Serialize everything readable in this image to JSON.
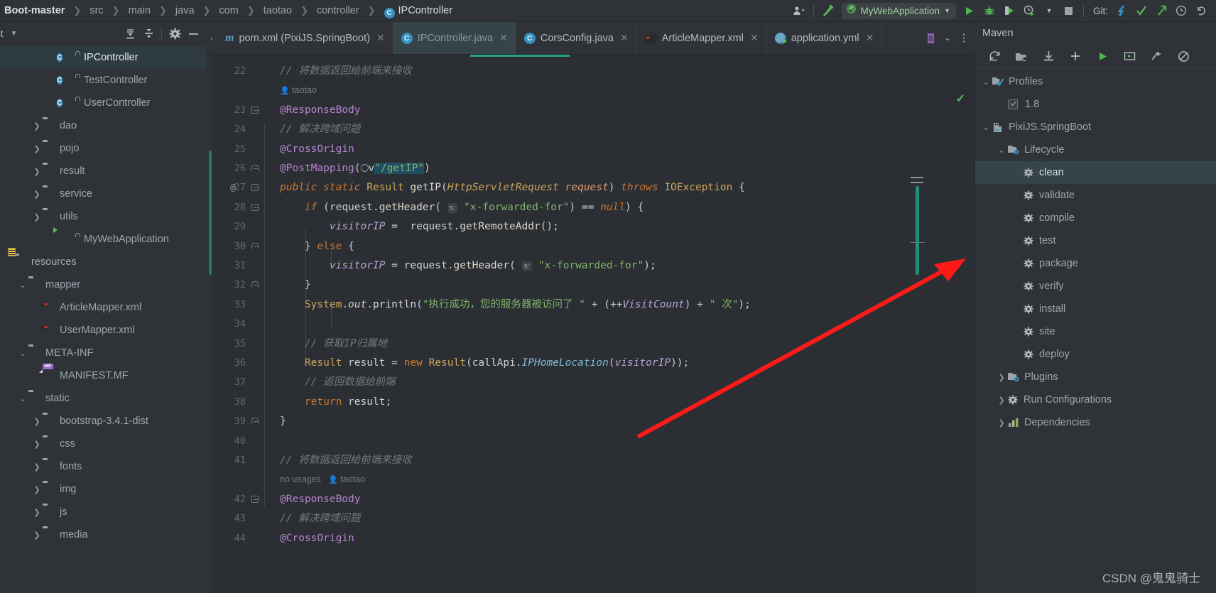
{
  "window": {
    "breadcrumb": [
      "Boot-master",
      "src",
      "main",
      "java",
      "com",
      "taotao",
      "controller",
      "IPController"
    ],
    "class_badge": "C"
  },
  "toolbar": {
    "profile_icon": "user-profile-icon",
    "hammer_icon": "build-hammer-icon",
    "run_config_name": "MyWebApplication",
    "run_config_icon": "spring-boot-icon",
    "dropdown_icon": "chevron-down-icon",
    "run_icon": "run-play-icon",
    "debug_icon": "debug-bug-icon",
    "run_coverage_icon": "run-with-coverage-icon",
    "profiler_icon": "profiler-clock-icon",
    "stop_icon": "stop-square-icon",
    "git_label": "Git:",
    "git_update_icon": "update-project-icon",
    "git_commit_icon": "commit-checkmark-icon",
    "git_push_icon": "push-arrow-icon",
    "git_history_icon": "history-clock-icon",
    "git_rollback_icon": "rollback-undo-icon"
  },
  "project_panel": {
    "title": "ct",
    "caret_icon": "chevron-down-icon",
    "tools": [
      "expand-all-icon",
      "collapse-all-icon",
      "gear-icon",
      "hide-minus-icon"
    ],
    "tree": [
      {
        "label": "IPController",
        "indent": 4,
        "icon": "java-class-icon",
        "lock": true,
        "twist": "",
        "selected": true
      },
      {
        "label": "TestController",
        "indent": 4,
        "icon": "java-class-icon",
        "lock": true,
        "twist": "",
        "selected": false
      },
      {
        "label": "UserController",
        "indent": 4,
        "icon": "java-class-icon",
        "lock": true,
        "twist": "",
        "selected": false
      },
      {
        "label": "dao",
        "indent": 3,
        "icon": "source-folder-icon",
        "lock": false,
        "twist": ">",
        "selected": false
      },
      {
        "label": "pojo",
        "indent": 3,
        "icon": "source-folder-icon",
        "lock": false,
        "twist": ">",
        "selected": false
      },
      {
        "label": "result",
        "indent": 3,
        "icon": "source-folder-icon",
        "lock": false,
        "twist": ">",
        "selected": false
      },
      {
        "label": "service",
        "indent": 3,
        "icon": "source-folder-icon",
        "lock": false,
        "twist": ">",
        "selected": false
      },
      {
        "label": "utils",
        "indent": 3,
        "icon": "source-folder-icon",
        "lock": false,
        "twist": ">",
        "selected": false
      },
      {
        "label": "MyWebApplication",
        "indent": 4,
        "icon": "spring-boot-run-icon",
        "lock": true,
        "twist": "",
        "selected": false
      },
      {
        "label": "resources",
        "indent": 1,
        "icon": "resource-folder-icon",
        "lock": false,
        "twist": "",
        "selected": false
      },
      {
        "label": "mapper",
        "indent": 2,
        "icon": "folder-icon",
        "lock": false,
        "twist": "v",
        "selected": false
      },
      {
        "label": "ArticleMapper.xml",
        "indent": 3,
        "icon": "mybatis-file-icon",
        "lock": false,
        "twist": "",
        "selected": false
      },
      {
        "label": "UserMapper.xml",
        "indent": 3,
        "icon": "mybatis-file-icon",
        "lock": false,
        "twist": "",
        "selected": false
      },
      {
        "label": "META-INF",
        "indent": 2,
        "icon": "folder-icon",
        "lock": false,
        "twist": "v",
        "selected": false
      },
      {
        "label": "MANIFEST.MF",
        "indent": 3,
        "icon": "manifest-file-icon",
        "lock": false,
        "twist": "",
        "selected": false
      },
      {
        "label": "static",
        "indent": 2,
        "icon": "folder-icon",
        "lock": false,
        "twist": "v",
        "selected": false
      },
      {
        "label": "bootstrap-3.4.1-dist",
        "indent": 3,
        "icon": "folder-icon",
        "lock": false,
        "twist": ">",
        "selected": false
      },
      {
        "label": "css",
        "indent": 3,
        "icon": "folder-icon",
        "lock": false,
        "twist": ">",
        "selected": false
      },
      {
        "label": "fonts",
        "indent": 3,
        "icon": "folder-icon",
        "lock": false,
        "twist": ">",
        "selected": false
      },
      {
        "label": "img",
        "indent": 3,
        "icon": "folder-icon",
        "lock": false,
        "twist": ">",
        "selected": false
      },
      {
        "label": "js",
        "indent": 3,
        "icon": "folder-icon",
        "lock": false,
        "twist": ">",
        "selected": false
      },
      {
        "label": "media",
        "indent": 3,
        "icon": "folder-icon",
        "lock": false,
        "twist": ">",
        "selected": false
      }
    ]
  },
  "editor": {
    "tabs": [
      {
        "label": "pom.xml (PixiJS.SpringBoot)",
        "icon": "maven-m-icon",
        "active": false,
        "closable": true
      },
      {
        "label": "IPController.java",
        "icon": "java-class-icon",
        "active": true,
        "closable": true
      },
      {
        "label": "CorsConfig.java",
        "icon": "java-class-icon",
        "active": false,
        "closable": true
      },
      {
        "label": "ArticleMapper.xml",
        "icon": "mybatis-file-icon",
        "active": false,
        "closable": true
      },
      {
        "label": "application.yml",
        "icon": "spring-yaml-icon",
        "active": false,
        "closable": true
      }
    ],
    "tab_right_buttons": [
      "yaml-file-icon",
      "chevron-down-icon",
      "more-vertical-icon"
    ],
    "inspection_status_icon": "inspections-ok-check",
    "lines": [
      {
        "no": "22",
        "kind": "code",
        "fold": "",
        "at": false,
        "html": "<span class=\"cmt\">// 将数据返回给前端来接收</span>"
      },
      {
        "no": "",
        "kind": "author",
        "text": "taotao"
      },
      {
        "no": "23",
        "kind": "code",
        "fold": "down",
        "at": false,
        "html": "<span class=\"anno\">@ResponseBody</span>"
      },
      {
        "no": "24",
        "kind": "code",
        "fold": "",
        "at": false,
        "html": "<span class=\"cmt\">// 解决跨域问题</span>"
      },
      {
        "no": "25",
        "kind": "code",
        "fold": "",
        "at": false,
        "html": "<span class=\"anno\">@CrossOrigin</span>"
      },
      {
        "no": "26",
        "kind": "code",
        "fold": "up",
        "at": false,
        "html": "<span class=\"anno\">@PostMapping</span><span class=\"pun\">(</span><span class=\"web-ic\"></span><span class=\"pun\">v</span><span class=\"str sel-str\">\"/getIP\"</span><span class=\"pun\">)</span>"
      },
      {
        "no": "27",
        "kind": "code",
        "fold": "down",
        "at": true,
        "html": "<span class=\"kw2\">public static</span> <span class=\"typ\">Result</span> <span class=\"mth\">getIP</span><span class=\"pun\">(</span><span class=\"typ\" style=\"font-style:italic\">HttpServletRequest</span> <span class=\"param\">request</span><span class=\"pun\">)</span> <span class=\"kw2\">throws</span> <span class=\"typ\">IOException</span> <span class=\"pun\">{</span>"
      },
      {
        "no": "28",
        "kind": "code",
        "fold": "down",
        "at": false,
        "html": "    <span class=\"kw2\">if</span> <span class=\"pun\">(</span><span class=\"ident\">request</span><span class=\"pun\">.</span><span class=\"mth\">getHeader</span><span class=\"pun\">(</span> <span class=\"hint\">s:</span> <span class=\"str\">\"x-forwarded-for\"</span><span class=\"pun\">)</span> <span class=\"pun\">==</span> <span class=\"kw2\">null</span><span class=\"pun\">)</span> <span class=\"pun\">{</span>"
      },
      {
        "no": "29",
        "kind": "code",
        "fold": "",
        "at": false,
        "html": "        <span class=\"fld\">visitorIP</span> <span class=\"pun\">=</span>  <span class=\"ident\">request</span><span class=\"pun\">.</span><span class=\"mth\">getRemoteAddr</span><span class=\"pun\">();</span>"
      },
      {
        "no": "30",
        "kind": "code",
        "fold": "up",
        "at": false,
        "html": "    <span class=\"pun\">}</span> <span class=\"kw\">else</span> <span class=\"pun\">{</span>"
      },
      {
        "no": "31",
        "kind": "code",
        "fold": "",
        "at": false,
        "html": "        <span class=\"fld\">visitorIP</span> <span class=\"pun\">=</span> <span class=\"ident\">request</span><span class=\"pun\">.</span><span class=\"mth\">getHeader</span><span class=\"pun\">(</span> <span class=\"hint\">s:</span> <span class=\"str\">\"x-forwarded-for\"</span><span class=\"pun\">);</span>"
      },
      {
        "no": "32",
        "kind": "code",
        "fold": "up",
        "at": false,
        "html": "    <span class=\"pun\">}</span>"
      },
      {
        "no": "33",
        "kind": "code",
        "fold": "",
        "at": false,
        "html": "    <span class=\"typ\">System</span><span class=\"pun\">.</span><span class=\"stc\">out</span><span class=\"pun\">.</span><span class=\"mth\">println</span><span class=\"pun\">(</span><span class=\"str\">\"执行成功，您的服务器被访问了 \"</span> <span class=\"pun\">+</span> <span class=\"pun\">(</span><span class=\"pun\">++</span><span class=\"fld\">VisitCount</span><span class=\"pun\">)</span> <span class=\"pun\">+</span> <span class=\"str\">\" 次\"</span><span class=\"pun\">);</span>"
      },
      {
        "no": "34",
        "kind": "code",
        "fold": "",
        "at": false,
        "html": ""
      },
      {
        "no": "35",
        "kind": "code",
        "fold": "",
        "at": false,
        "html": "    <span class=\"cmt\">// 获取IP归属地</span>"
      },
      {
        "no": "36",
        "kind": "code",
        "fold": "",
        "at": false,
        "html": "    <span class=\"typ\">Result</span> <span class=\"ident\">result</span> <span class=\"pun\">=</span> <span class=\"kw\">new</span> <span class=\"typ\">Result</span><span class=\"pun\">(</span><span class=\"ident\">callApi</span><span class=\"pun\">.</span><span class=\"lnk\">IPHomeLocation</span><span class=\"pun\">(</span><span class=\"fld\">visitorIP</span><span class=\"pun\">));</span>"
      },
      {
        "no": "37",
        "kind": "code",
        "fold": "",
        "at": false,
        "html": "    <span class=\"cmt\">// 返回数据给前端</span>"
      },
      {
        "no": "38",
        "kind": "code",
        "fold": "",
        "at": false,
        "html": "    <span class=\"kw\">return</span> <span class=\"ident\">result</span><span class=\"pun\">;</span>"
      },
      {
        "no": "39",
        "kind": "code",
        "fold": "up",
        "at": false,
        "html": "<span class=\"pun\">}</span>"
      },
      {
        "no": "40",
        "kind": "code",
        "fold": "",
        "at": false,
        "html": ""
      },
      {
        "no": "41",
        "kind": "code",
        "fold": "",
        "at": false,
        "html": "<span class=\"cmt\">// 将数据返回给前端来接收</span>"
      },
      {
        "no": "",
        "kind": "usages",
        "usages_text": "no usages",
        "text": "taotao"
      },
      {
        "no": "42",
        "kind": "code",
        "fold": "down",
        "at": false,
        "html": "<span class=\"anno\">@ResponseBody</span>"
      },
      {
        "no": "43",
        "kind": "code",
        "fold": "",
        "at": false,
        "html": "<span class=\"cmt\">// 解决跨域问题</span>"
      },
      {
        "no": "44",
        "kind": "code",
        "fold": "",
        "at": false,
        "html": "<span class=\"anno\">@CrossOrigin</span>"
      }
    ]
  },
  "maven_panel": {
    "title": "Maven",
    "toolbar": [
      "reload-all-projects-icon",
      "add-maven-project-icon",
      "download-sources-icon",
      "add-plus-icon",
      "execute-goal-run-icon",
      "toggle-offline-mode-icon",
      "skip-tests-icon",
      "show-dependencies-disabled-icon"
    ],
    "tree": [
      {
        "label": "Profiles",
        "indent": 1,
        "twist": "v",
        "icon": "profiles-icon",
        "selected": false
      },
      {
        "label": "1.8",
        "indent": 2,
        "twist": "",
        "icon": "checkbox-checked",
        "selected": false
      },
      {
        "label": "PixiJS.SpringBoot",
        "indent": 1,
        "twist": "v",
        "icon": "maven-project-icon",
        "selected": false
      },
      {
        "label": "Lifecycle",
        "indent": 2,
        "twist": "v",
        "icon": "lifecycle-folder-icon",
        "selected": false
      },
      {
        "label": "clean",
        "indent": 3,
        "twist": "",
        "icon": "gear-icon",
        "selected": true
      },
      {
        "label": "validate",
        "indent": 3,
        "twist": "",
        "icon": "gear-icon",
        "selected": false
      },
      {
        "label": "compile",
        "indent": 3,
        "twist": "",
        "icon": "gear-icon",
        "selected": false
      },
      {
        "label": "test",
        "indent": 3,
        "twist": "",
        "icon": "gear-icon",
        "selected": false
      },
      {
        "label": "package",
        "indent": 3,
        "twist": "",
        "icon": "gear-icon",
        "selected": false
      },
      {
        "label": "verify",
        "indent": 3,
        "twist": "",
        "icon": "gear-icon",
        "selected": false
      },
      {
        "label": "install",
        "indent": 3,
        "twist": "",
        "icon": "gear-icon",
        "selected": false
      },
      {
        "label": "site",
        "indent": 3,
        "twist": "",
        "icon": "gear-icon",
        "selected": false
      },
      {
        "label": "deploy",
        "indent": 3,
        "twist": "",
        "icon": "gear-icon",
        "selected": false
      },
      {
        "label": "Plugins",
        "indent": 2,
        "twist": ">",
        "icon": "plugins-folder-icon",
        "selected": false
      },
      {
        "label": "Run Configurations",
        "indent": 2,
        "twist": ">",
        "icon": "gear-icon",
        "selected": false
      },
      {
        "label": "Dependencies",
        "indent": 2,
        "twist": ">",
        "icon": "dependencies-icon",
        "selected": false
      }
    ]
  },
  "annotation": {
    "arrow_color": "#ff1a1a",
    "arrow_target": "package",
    "watermark": "CSDN @鬼鬼骑士"
  },
  "colors": {
    "bg": "#2b2f33",
    "panel_bg": "#2f3337",
    "accent_green": "#5eb762",
    "accent_blue": "#3592c4",
    "selection": "#2e3b42",
    "progress": "#24a08a"
  }
}
